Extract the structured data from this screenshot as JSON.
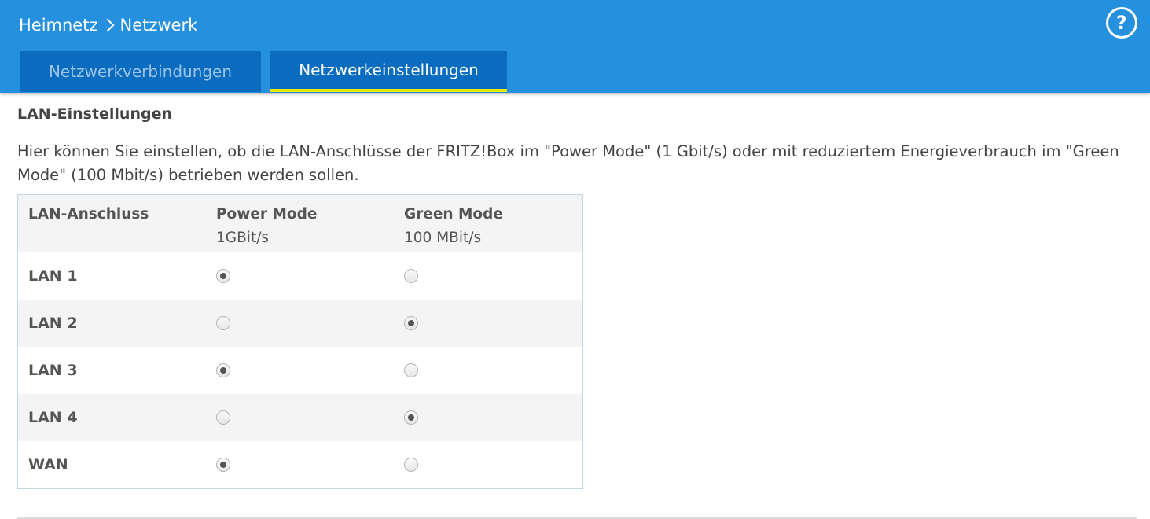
{
  "breadcrumb": {
    "parent": "Heimnetz",
    "current": "Netzwerk"
  },
  "help": {
    "label": "?"
  },
  "tabs": [
    {
      "label": "Netzwerkverbindungen",
      "active": false
    },
    {
      "label": "Netzwerkeinstellungen",
      "active": true
    }
  ],
  "section": {
    "title": "LAN-Einstellungen",
    "description": "Hier können Sie einstellen, ob die LAN-Anschlüsse der FRITZ!Box im \"Power Mode\" (1 Gbit/s) oder mit reduziertem Energieverbrauch im \"Green Mode\" (100 Mbit/s) betrieben werden sollen."
  },
  "table": {
    "columns": {
      "port": {
        "label": "LAN-Anschluss"
      },
      "power": {
        "label": "Power Mode",
        "sub": "1GBit/s"
      },
      "green": {
        "label": "Green Mode",
        "sub": "100 MBit/s"
      }
    },
    "rows": [
      {
        "port": "LAN 1",
        "mode": "power"
      },
      {
        "port": "LAN 2",
        "mode": "green"
      },
      {
        "port": "LAN 3",
        "mode": "power"
      },
      {
        "port": "LAN 4",
        "mode": "green"
      },
      {
        "port": "WAN",
        "mode": "power"
      }
    ]
  },
  "colors": {
    "header_bg": "#2590de",
    "tab_bg": "#0a6cbf",
    "active_tab_underline": "#e8e800"
  }
}
